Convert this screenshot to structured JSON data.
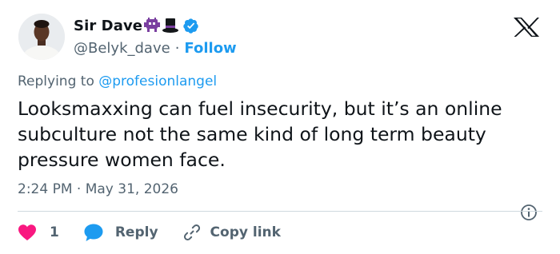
{
  "author": {
    "display_name": "Sir Dave",
    "handle": "@Belyk_dave",
    "separator": "·",
    "follow_label": "Follow"
  },
  "reply_context": {
    "prefix": "Replying to",
    "mention": "@profesionlangel"
  },
  "tweet": {
    "text": "Looksmaxxing can fuel insecurity, but it’s an online subculture not the same kind of long term beauty pressure women face.",
    "timestamp": "2:24 PM · May 31, 2026"
  },
  "actions": {
    "like_count": "1",
    "reply_label": "Reply",
    "copy_link_label": "Copy link"
  },
  "icons": {
    "platform": "x-logo-icon",
    "badge": "verified-badge-icon",
    "emoji_1": "alien-monster-icon",
    "emoji_2": "top-hat-icon",
    "info": "info-icon",
    "like": "heart-icon",
    "reply": "reply-bubble-icon",
    "copy": "link-icon"
  },
  "colors": {
    "accent": "#1d9bf0",
    "like": "#f91880",
    "text": "#0f1419",
    "secondary": "#536471",
    "emoji_purple": "#7a3fa0"
  }
}
